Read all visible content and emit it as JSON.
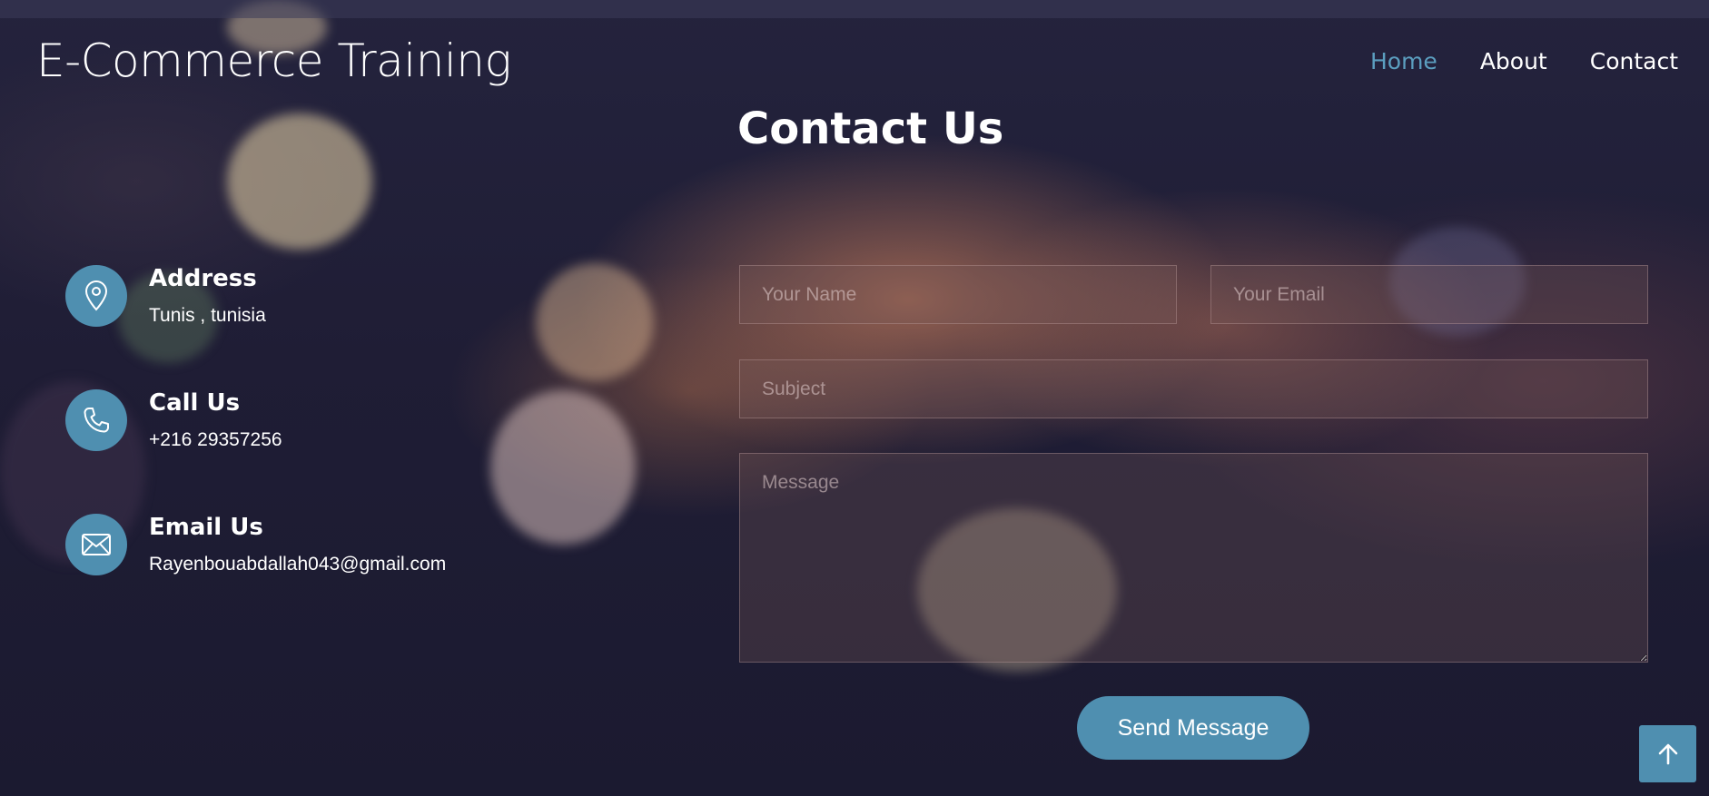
{
  "header": {
    "logo": "E-Commerce Training",
    "nav": [
      {
        "label": "Home",
        "active": true
      },
      {
        "label": "About",
        "active": false
      },
      {
        "label": "Contact",
        "active": false
      }
    ]
  },
  "page_title": "Contact Us",
  "contact_info": {
    "address": {
      "heading": "Address",
      "value": "Tunis , tunisia",
      "icon": "map-pin-icon"
    },
    "phone": {
      "heading": "Call Us",
      "value": "+216 29357256",
      "icon": "phone-icon"
    },
    "email": {
      "heading": "Email Us",
      "value": "Rayenbouabdallah043@gmail.com",
      "icon": "envelope-icon"
    }
  },
  "form": {
    "name_placeholder": "Your Name",
    "email_placeholder": "Your Email",
    "subject_placeholder": "Subject",
    "message_placeholder": "Message",
    "submit_label": "Send Message"
  },
  "scroll_top": {
    "icon": "arrow-up-icon"
  },
  "colors": {
    "accent": "#4f8fb0",
    "nav_active": "#5b9ebf"
  }
}
